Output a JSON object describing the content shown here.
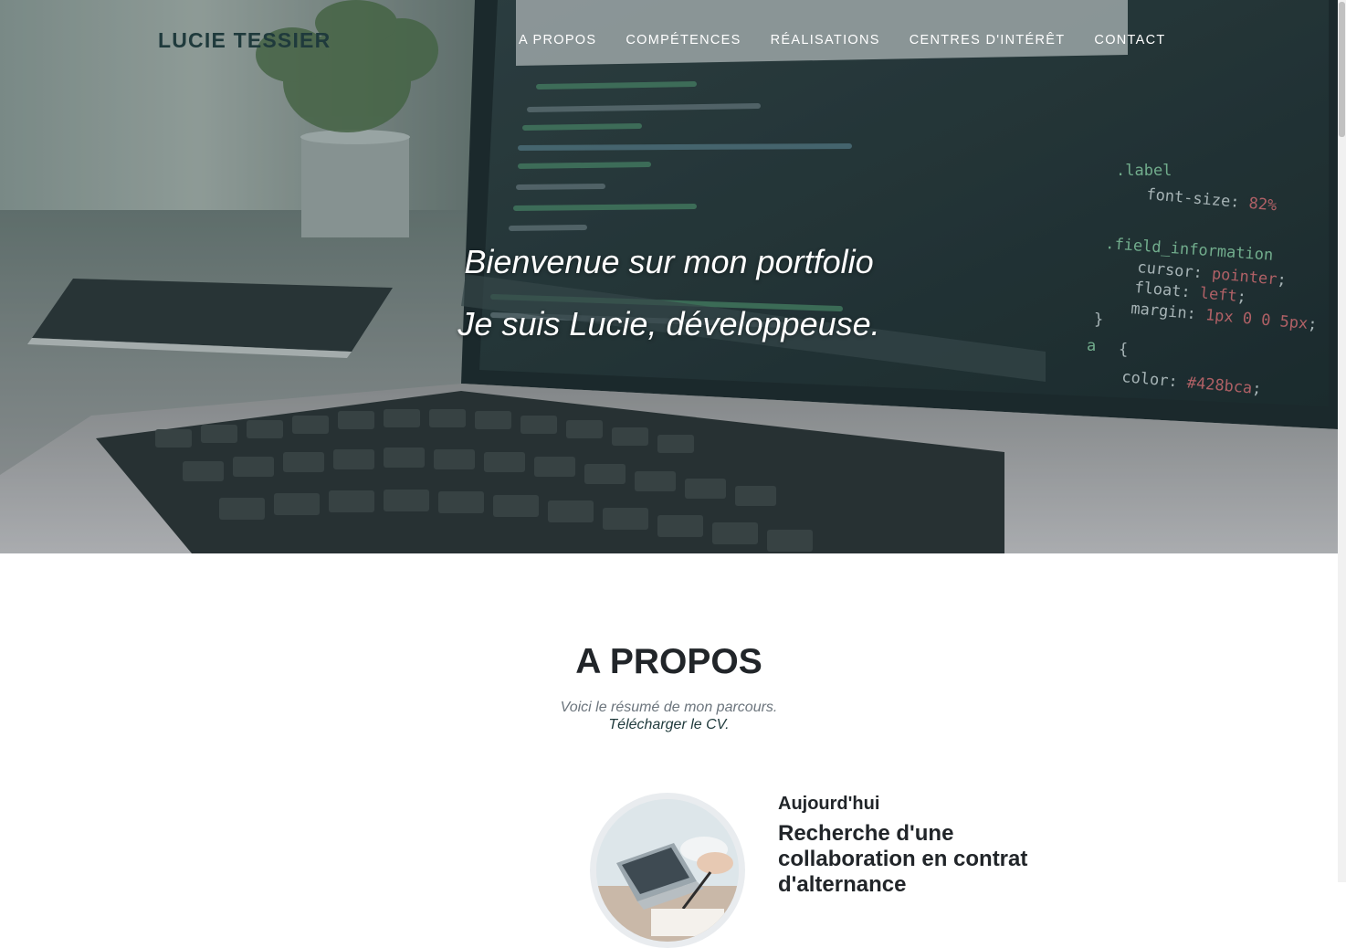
{
  "brand": "LUCIE TESSIER",
  "nav": {
    "items": [
      {
        "label": "A PROPOS"
      },
      {
        "label": "COMPÉTENCES"
      },
      {
        "label": "RÉALISATIONS"
      },
      {
        "label": "CENTRES D'INTÉRÊT"
      },
      {
        "label": "CONTACT"
      }
    ]
  },
  "hero": {
    "line1": "Bienvenue sur mon portfolio",
    "line2": "Je suis Lucie, développeuse."
  },
  "about": {
    "title": "A PROPOS",
    "subtitle": "Voici le résumé de mon parcours.",
    "cv_link": "Télécharger le CV.",
    "timeline": [
      {
        "date": "Aujourd'hui",
        "heading": "Recherche d'une collaboration en contrat d'alternance"
      }
    ]
  },
  "colors": {
    "brand": "#1f3a3c",
    "nav_text": "#ffffff",
    "heading": "#212529",
    "muted": "#6c757d"
  }
}
